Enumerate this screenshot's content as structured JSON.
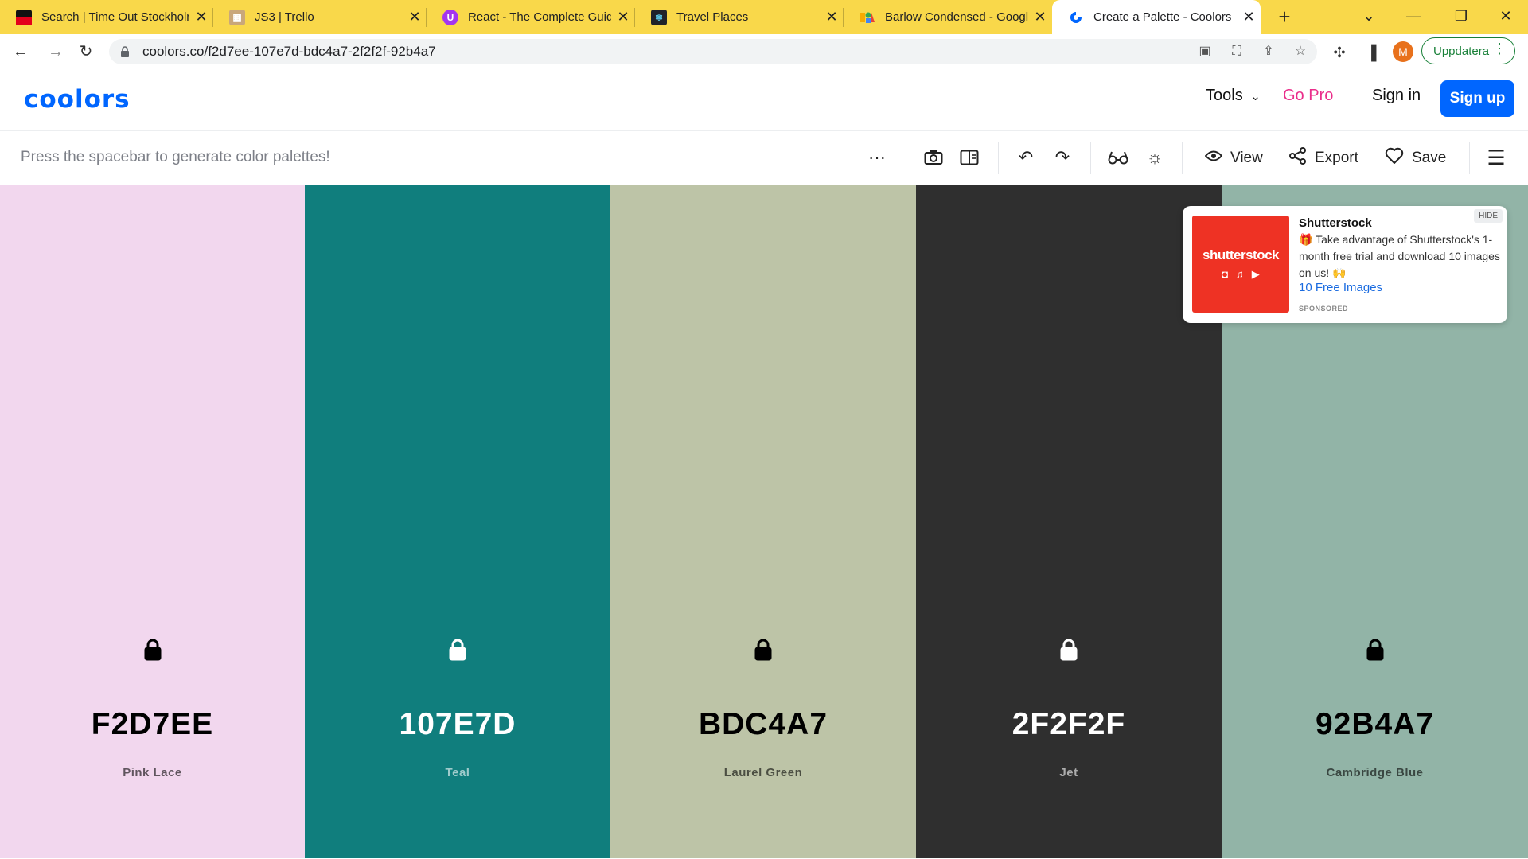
{
  "browser": {
    "tabs": [
      {
        "title": "Search | Time Out Stockholm",
        "favicon": "timeout-favicon",
        "fav_color": "#e3001b"
      },
      {
        "title": "JS3 | Trello",
        "favicon": "trello-favicon",
        "fav_color": "#b58a57"
      },
      {
        "title": "React - The Complete Guide",
        "favicon": "udemy-favicon",
        "fav_color": "#a435f0"
      },
      {
        "title": "Travel Places",
        "favicon": "react-favicon",
        "fav_color": "#20232a"
      },
      {
        "title": "Barlow Condensed - Google Fonts",
        "favicon": "google-fonts-favicon",
        "fav_color": "#4285f4"
      },
      {
        "title": "Create a Palette - Coolors",
        "favicon": "coolors-favicon",
        "fav_color": "#0066ff"
      }
    ],
    "url": "coolors.co/f2d7ee-107e7d-bdc4a7-2f2f2f-92b4a7",
    "avatar_letter": "M",
    "update_label": "Uppdatera"
  },
  "site": {
    "logo": "coolors",
    "nav": {
      "tools": "Tools",
      "go_pro": "Go Pro",
      "sign_in": "Sign in",
      "sign_up": "Sign up"
    }
  },
  "generator": {
    "hint": "Press the spacebar to generate color palettes!",
    "view_label": "View",
    "export_label": "Export",
    "save_label": "Save"
  },
  "palette": [
    {
      "hex": "F2D7EE",
      "name": "Pink Lace",
      "color": "#f2d7ee",
      "text_color": "#000000"
    },
    {
      "hex": "107E7D",
      "name": "Teal",
      "color": "#107e7d",
      "text_color": "#ffffff"
    },
    {
      "hex": "BDC4A7",
      "name": "Laurel Green",
      "color": "#bdc4a7",
      "text_color": "#000000"
    },
    {
      "hex": "2F2F2F",
      "name": "Jet",
      "color": "#2f2f2f",
      "text_color": "#ffffff"
    },
    {
      "hex": "92B4A7",
      "name": "Cambridge Blue",
      "color": "#92b4a7",
      "text_color": "#000000"
    }
  ],
  "ad": {
    "hide": "HIDE",
    "brand": "shutterstock",
    "title": "Shutterstock",
    "text": "🎁 Take advantage of Shutterstock's 1-month free trial and download 10 images on us! 🙌",
    "link": "10 Free Images",
    "sponsored": "SPONSORED"
  },
  "colors": {
    "accent": "#0066ff",
    "pro": "#ea2e8b",
    "tabstrip": "#f9d84a"
  }
}
